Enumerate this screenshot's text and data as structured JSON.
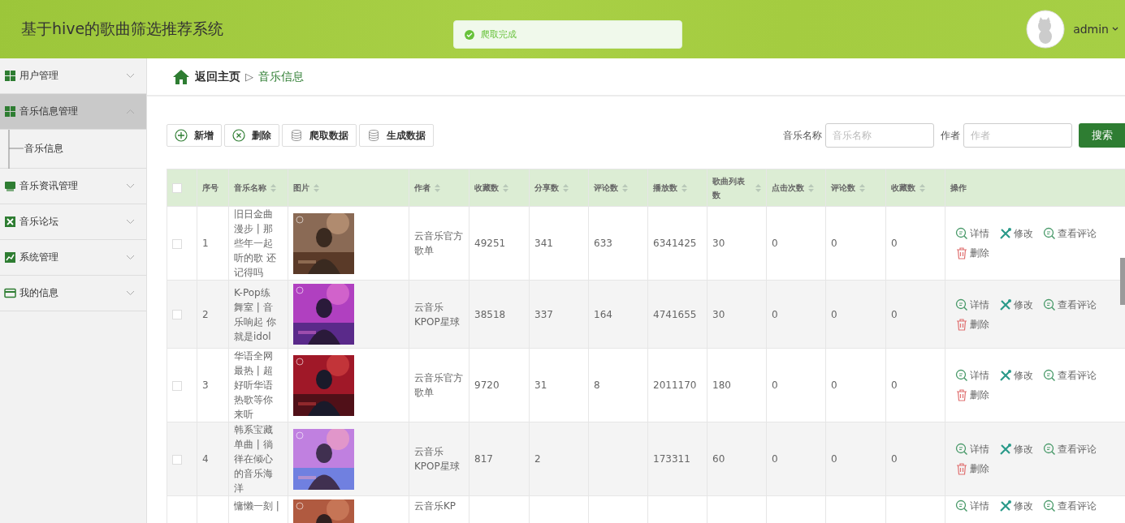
{
  "header": {
    "title": "基于hive的歌曲筛选推荐系统",
    "user": "admin"
  },
  "toast": {
    "message": "爬取完成"
  },
  "sidebar": {
    "items": [
      {
        "label": "用户管理",
        "expanded": false,
        "selected": false
      },
      {
        "label": "音乐信息管理",
        "expanded": true,
        "selected": true,
        "children": [
          {
            "label": "音乐信息",
            "selected": false
          }
        ]
      },
      {
        "label": "音乐资讯管理",
        "expanded": false,
        "selected": false
      },
      {
        "label": "音乐论坛",
        "expanded": false,
        "selected": false
      },
      {
        "label": "系统管理",
        "expanded": false,
        "selected": false
      },
      {
        "label": "我的信息",
        "expanded": false,
        "selected": false
      }
    ]
  },
  "breadcrumb": {
    "home": "返回主页",
    "separator": "▷",
    "current": "音乐信息"
  },
  "toolbar": {
    "buttons": [
      {
        "label": "新增",
        "kind": "add"
      },
      {
        "label": "删除",
        "kind": "remove"
      },
      {
        "label": "爬取数据",
        "kind": "database"
      },
      {
        "label": "生成数据",
        "kind": "database"
      }
    ]
  },
  "search": {
    "fields": [
      {
        "label": "音乐名称",
        "placeholder": "音乐名称"
      },
      {
        "label": "作者",
        "placeholder": "作者"
      }
    ],
    "button": "搜索"
  },
  "table": {
    "header_checked": false,
    "columns": [
      {
        "label": "序号",
        "sortable": false
      },
      {
        "label": "音乐名称",
        "sortable": true
      },
      {
        "label": "图片",
        "sortable": true
      },
      {
        "label": "作者",
        "sortable": true
      },
      {
        "label": "收藏数",
        "sortable": true
      },
      {
        "label": "分享数",
        "sortable": true
      },
      {
        "label": "评论数",
        "sortable": true
      },
      {
        "label": "播放数",
        "sortable": true
      },
      {
        "label": "歌曲列表数",
        "sortable": true
      },
      {
        "label": "点击次数",
        "sortable": true
      },
      {
        "label": "评论数",
        "sortable": true
      },
      {
        "label": "收藏数",
        "sortable": true
      },
      {
        "label": "操作",
        "sortable": false
      }
    ],
    "rows": [
      {
        "checked": false,
        "no": "1",
        "name": "旧日金曲漫步 | 那些年一起听的歌 还记得吗",
        "picture": {
          "kind": "picture"
        },
        "author": "云音乐官方歌单",
        "stats": {
          "favorites": "49251",
          "shares": "341",
          "comments": "633",
          "plays": "6341425",
          "playlists": "30",
          "clicks": "0",
          "comments_2": "0",
          "favorites_2": "0"
        },
        "actions": [
          {
            "label": "详情",
            "kind": "detail"
          },
          {
            "label": "修改",
            "kind": "edit"
          },
          {
            "label": "查看评论",
            "kind": "detail"
          },
          {
            "label": "删除",
            "kind": "delete"
          }
        ]
      },
      {
        "checked": false,
        "no": "2",
        "name": "K-Pop练舞室 | 音乐响起 你就是idol",
        "picture": {
          "kind": "picture"
        },
        "author": "云音乐KPOP星球",
        "stats": {
          "favorites": "38518",
          "shares": "337",
          "comments": "164",
          "plays": "4741655",
          "playlists": "30",
          "clicks": "0",
          "comments_2": "0",
          "favorites_2": "0"
        },
        "actions": [
          {
            "label": "详情",
            "kind": "detail"
          },
          {
            "label": "修改",
            "kind": "edit"
          },
          {
            "label": "查看评论",
            "kind": "detail"
          },
          {
            "label": "删除",
            "kind": "delete"
          }
        ]
      },
      {
        "checked": false,
        "no": "3",
        "name": "华语全网最热 | 超好听华语热歌等你来听",
        "picture": {
          "kind": "picture"
        },
        "author": "云音乐官方歌单",
        "stats": {
          "favorites": "9720",
          "shares": "31",
          "comments": "8",
          "plays": "2011170",
          "playlists": "180",
          "clicks": "0",
          "comments_2": "0",
          "favorites_2": "0"
        },
        "actions": [
          {
            "label": "详情",
            "kind": "detail"
          },
          {
            "label": "修改",
            "kind": "edit"
          },
          {
            "label": "查看评论",
            "kind": "detail"
          },
          {
            "label": "删除",
            "kind": "delete"
          }
        ]
      },
      {
        "checked": false,
        "no": "4",
        "name": "韩系宝藏单曲 | 徜徉在倾心的音乐海洋",
        "picture": {
          "kind": "picture"
        },
        "author": "云音乐KPOP星球",
        "stats": {
          "favorites": "817",
          "shares": "2",
          "plays": "173311",
          "playlists": "60",
          "clicks": "0",
          "comments_2": "0",
          "favorites_2": "0"
        },
        "actions": [
          {
            "label": "详情",
            "kind": "detail"
          },
          {
            "label": "修改",
            "kind": "edit"
          },
          {
            "label": "查看评论",
            "kind": "detail"
          },
          {
            "label": "删除",
            "kind": "delete"
          }
        ]
      },
      {
        "name": "慵懒一刻 |",
        "picture": {
          "kind": "picture"
        },
        "author": "云音乐KP",
        "actions": [
          {
            "label": "详情",
            "kind": "detail"
          },
          {
            "label": "修改",
            "kind": "edit"
          },
          {
            "label": "查看评论",
            "kind": "detail"
          }
        ]
      }
    ]
  }
}
